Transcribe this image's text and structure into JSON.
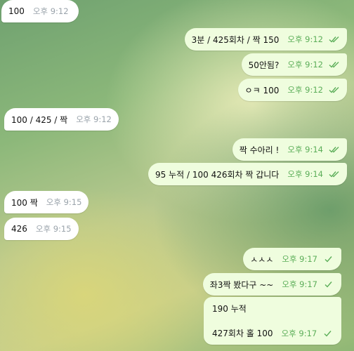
{
  "messages": [
    {
      "id": "m1",
      "direction": "incoming",
      "text": "100",
      "time": "오후 9:12"
    },
    {
      "id": "m2",
      "direction": "outgoing",
      "text": "3분 / 425회차 / 짝 150",
      "time": "오후 9:12",
      "status": "read"
    },
    {
      "id": "m3",
      "direction": "outgoing",
      "text": "50안됨?",
      "time": "오후 9:12",
      "status": "read"
    },
    {
      "id": "m4",
      "direction": "outgoing",
      "text": "ㅇㅋ 100",
      "time": "오후 9:12",
      "status": "read"
    },
    {
      "id": "m5",
      "direction": "incoming",
      "text": "100 / 425 / 짝",
      "time": "오후 9:12"
    },
    {
      "id": "m6",
      "direction": "outgoing",
      "text": "짝 수아리 !",
      "time": "오후 9:14",
      "status": "read"
    },
    {
      "id": "m7",
      "direction": "outgoing",
      "text": "95 누적 / 100 426회차 짝 갑니다",
      "time": "오후 9:14",
      "status": "read"
    },
    {
      "id": "m8",
      "direction": "incoming",
      "text": "100 짝",
      "time": "오후 9:15"
    },
    {
      "id": "m9",
      "direction": "incoming",
      "text": "426",
      "time": "오후 9:15"
    },
    {
      "id": "m10",
      "direction": "outgoing",
      "text": "ㅅㅅㅅ",
      "time": "오후 9:17",
      "status": "sent"
    },
    {
      "id": "m11",
      "direction": "outgoing",
      "text": "좌3짝 봤다구 ~~",
      "time": "오후 9:17",
      "status": "sent"
    },
    {
      "id": "m12",
      "direction": "outgoing",
      "line1": "190 누적",
      "line2": "427회차 홀 100",
      "time": "오후 9:17",
      "status": "sent"
    }
  ],
  "colors": {
    "incoming_bubble": "#ffffff",
    "outgoing_bubble": "#effdde",
    "outgoing_meta": "#5cae59",
    "incoming_meta": "#9aa3ab"
  }
}
